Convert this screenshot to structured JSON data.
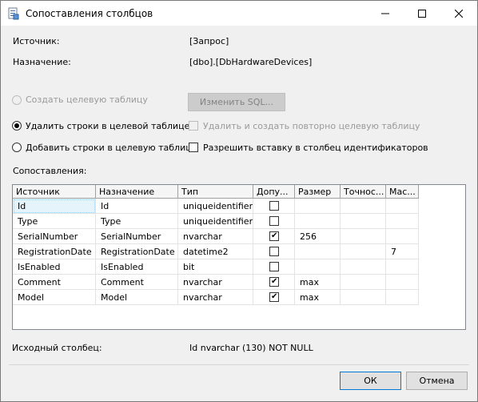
{
  "window": {
    "title": "Сопоставления столбцов"
  },
  "source": {
    "label": "Источник:",
    "value": "[Запрос]"
  },
  "destination": {
    "label": "Назначение:",
    "value": "[dbo].[DbHardwareDevices]"
  },
  "options": {
    "create_table": "Создать целевую таблицу",
    "edit_sql": "Изменить SQL...",
    "delete_rows": "Удалить строки в целевой таблице",
    "recreate_table": "Удалить и создать повторно целевую таблицу",
    "append_rows": "Добавить строки в целевую таблицу",
    "identity_insert": "Разрешить вставку в столбец идентификаторов",
    "selected": "delete_rows"
  },
  "mappings": {
    "label": "Сопоставления:",
    "columns": [
      "Источник",
      "Назначение",
      "Тип",
      "Допу...",
      "Размер",
      "Точнос...",
      "Мас..."
    ],
    "rows": [
      {
        "source": "Id",
        "destination": "Id",
        "type": "uniqueidentifier",
        "nullable": false,
        "size": "",
        "precision": "",
        "scale": ""
      },
      {
        "source": "Type",
        "destination": "Type",
        "type": "uniqueidentifier",
        "nullable": false,
        "size": "",
        "precision": "",
        "scale": ""
      },
      {
        "source": "SerialNumber",
        "destination": "SerialNumber",
        "type": "nvarchar",
        "nullable": true,
        "size": "256",
        "precision": "",
        "scale": ""
      },
      {
        "source": "RegistrationDate",
        "destination": "RegistrationDate",
        "type": "datetime2",
        "nullable": false,
        "size": "",
        "precision": "",
        "scale": "7"
      },
      {
        "source": "IsEnabled",
        "destination": "IsEnabled",
        "type": "bit",
        "nullable": false,
        "size": "",
        "precision": "",
        "scale": ""
      },
      {
        "source": "Comment",
        "destination": "Comment",
        "type": "nvarchar",
        "nullable": true,
        "size": "max",
        "precision": "",
        "scale": ""
      },
      {
        "source": "Model",
        "destination": "Model",
        "type": "nvarchar",
        "nullable": true,
        "size": "max",
        "precision": "",
        "scale": ""
      }
    ]
  },
  "source_column": {
    "label": "Исходный столбец:",
    "value": "Id nvarchar (130) NOT NULL"
  },
  "buttons": {
    "ok": "ОК",
    "cancel": "Отмена"
  },
  "colors": {
    "selected_cell": "#e5f3fb",
    "selected_cell_border": "#99d1ff",
    "primary_border": "#0078d7"
  }
}
